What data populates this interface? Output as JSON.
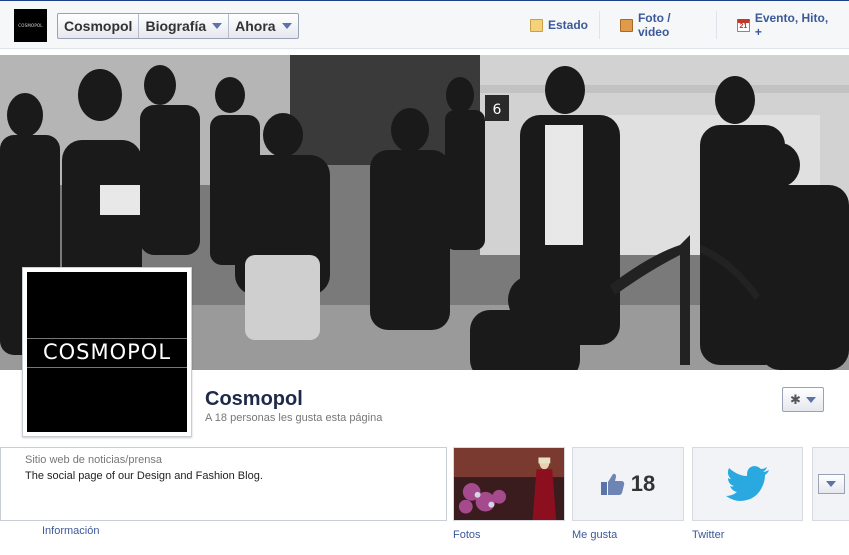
{
  "topbar": {
    "logo_text": "COSMOPOL",
    "nav": [
      {
        "label": "Cosmopol"
      },
      {
        "label": "Biografía"
      },
      {
        "label": "Ahora"
      }
    ],
    "actions": [
      {
        "label": "Estado",
        "icon": "note-icon"
      },
      {
        "label": "Foto / video",
        "icon": "photo-icon"
      },
      {
        "label": "Evento, Hito, +",
        "icon": "calendar-icon",
        "icon_text": "21"
      }
    ]
  },
  "cover": {
    "sign_number": "6"
  },
  "profile": {
    "logo_word": "COSMOPOL",
    "name": "Cosmopol",
    "likes_line": "A 18 personas les gusta esta página"
  },
  "about": {
    "category": "Sitio web de noticias/prensa",
    "description": "The social page of our Design and Fashion Blog.",
    "link": "Información"
  },
  "tiles": {
    "photos_label": "Fotos",
    "likes_count": "18",
    "likes_label": "Me gusta",
    "twitter_label": "Twitter"
  },
  "colors": {
    "link": "#3b5998",
    "twitter": "#2aa9e0"
  }
}
